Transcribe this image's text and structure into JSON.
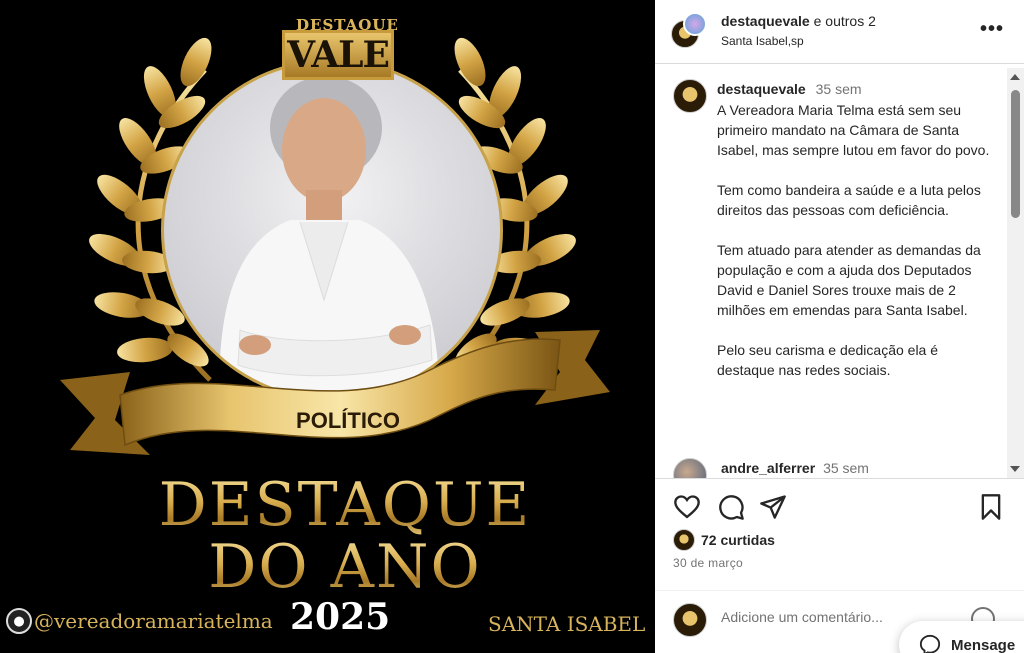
{
  "poster": {
    "brand_top": "DESTAQUE",
    "brand_main": "VALE",
    "category": "POLÍTICO",
    "title_line1": "DESTAQUE",
    "title_line2": "DO ANO",
    "year": "2025",
    "handle": "@vereadoramariatelma",
    "location": "SANTA ISABEL"
  },
  "header": {
    "username": "destaquevale",
    "coauthors": "e outros 2",
    "location": "Santa Isabel,sp",
    "more_icon": "more-horizontal-icon"
  },
  "caption": {
    "username": "destaquevale",
    "time": "35 sem",
    "paragraphs": [
      "A Vereadora Maria Telma está sem seu primeiro mandato na Câmara de Santa Isabel, mas sempre lutou em favor do povo.",
      "Tem como bandeira a saúde e a luta pelos direitos das pessoas com deficiência.",
      "Tem atuado para atender as demandas da população e com a ajuda dos Deputados David e Daniel Sores trouxe mais de 2 milhões em emendas para Santa Isabel.",
      "Pelo seu carisma e dedicação ela é destaque nas redes sociais."
    ]
  },
  "comment": {
    "username": "andre_alferrer",
    "time": "35 sem"
  },
  "actions": {
    "icons": [
      "heart-icon",
      "comment-icon",
      "share-icon",
      "bookmark-icon"
    ],
    "likes": "72 curtidas",
    "date": "30 de março"
  },
  "add_comment": {
    "placeholder": "Adicione um comentário...",
    "messages_label": "Mensage"
  },
  "colors": {
    "gold": "#d7b45c",
    "poster_bg": "#000000",
    "text": "#262626",
    "muted": "#737373"
  }
}
